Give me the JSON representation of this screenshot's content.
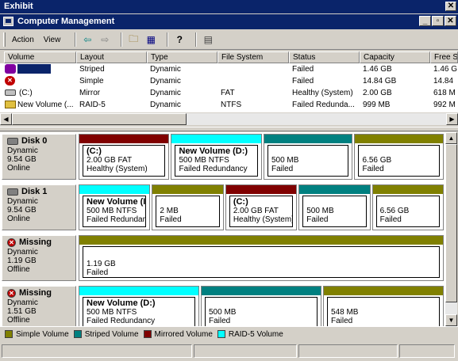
{
  "exhibit_title": "Exhibit",
  "window": {
    "title": "Computer Management"
  },
  "menu": [
    {
      "label": "Action"
    },
    {
      "label": "View"
    }
  ],
  "columns": [
    "Volume",
    "Layout",
    "Type",
    "File System",
    "Status",
    "Capacity",
    "Free S"
  ],
  "volumes": [
    {
      "name": "",
      "layout": "Striped",
      "type": "Dynamic",
      "fs": "",
      "status": "Failed",
      "capacity": "1.46 GB",
      "free": "1.46 G"
    },
    {
      "name": "",
      "layout": "Simple",
      "type": "Dynamic",
      "fs": "",
      "status": "Failed",
      "capacity": "14.84 GB",
      "free": "14.84"
    },
    {
      "name": "(C:)",
      "layout": "Mirror",
      "type": "Dynamic",
      "fs": "FAT",
      "status": "Healthy (System)",
      "capacity": "2.00 GB",
      "free": "618 M"
    },
    {
      "name": "New Volume (...",
      "layout": "RAID-5",
      "type": "Dynamic",
      "fs": "NTFS",
      "status": "Failed Redunda...",
      "capacity": "999 MB",
      "free": "992 M"
    }
  ],
  "disks": [
    {
      "name": "Disk 0",
      "type": "Dynamic",
      "size": "9.54 GB",
      "state": "Online",
      "partitions": [
        {
          "title": "(C:)",
          "line1": "2.00 GB FAT",
          "line2": "Healthy (System)",
          "kind": "mirrored"
        },
        {
          "title": "New Volume  (D:)",
          "line1": "500 MB NTFS",
          "line2": "Failed Redundancy",
          "kind": "raid5"
        },
        {
          "title": "",
          "line1": "500 MB",
          "line2": "Failed",
          "kind": "striped"
        },
        {
          "title": "",
          "line1": "6.56 GB",
          "line2": "Failed",
          "kind": "simple"
        }
      ]
    },
    {
      "name": "Disk 1",
      "type": "Dynamic",
      "size": "9.54 GB",
      "state": "Online",
      "partitions": [
        {
          "title": "New Volume  (I",
          "line1": "500 MB NTFS",
          "line2": "Failed Redundanc",
          "kind": "raid5"
        },
        {
          "title": "",
          "line1": "2 MB",
          "line2": "Failed",
          "kind": "simple"
        },
        {
          "title": "(C:)",
          "line1": "2.00 GB FAT",
          "line2": "Healthy (System)",
          "kind": "mirrored"
        },
        {
          "title": "",
          "line1": "500 MB",
          "line2": "Failed",
          "kind": "striped"
        },
        {
          "title": "",
          "line1": "6.56 GB",
          "line2": "Failed",
          "kind": "simple"
        }
      ]
    },
    {
      "name": "Missing",
      "type": "Dynamic",
      "size": "1.19 GB",
      "state": "Offline",
      "partitions": [
        {
          "title": "",
          "line1": "1.19 GB",
          "line2": "Failed",
          "kind": "simple"
        }
      ]
    },
    {
      "name": "Missing",
      "type": "Dynamic",
      "size": "1.51 GB",
      "state": "Offline",
      "partitions": [
        {
          "title": "New Volume  (D:)",
          "line1": "500 MB NTFS",
          "line2": "Failed Redundancy",
          "kind": "raid5"
        },
        {
          "title": "",
          "line1": "500 MB",
          "line2": "Failed",
          "kind": "striped"
        },
        {
          "title": "",
          "line1": "548 MB",
          "line2": "Failed",
          "kind": "simple"
        }
      ]
    }
  ],
  "legend": [
    {
      "label": "Simple Volume",
      "color": "#808000"
    },
    {
      "label": "Striped Volume",
      "color": "#008080"
    },
    {
      "label": "Mirrored Volume",
      "color": "#800000"
    },
    {
      "label": "RAID-5 Volume",
      "color": "#00ffff"
    }
  ],
  "colors": {
    "simple": "#808000",
    "striped": "#008080",
    "mirrored": "#800000",
    "raid5": "#00ffff",
    "titlebar": "#0a246a"
  }
}
